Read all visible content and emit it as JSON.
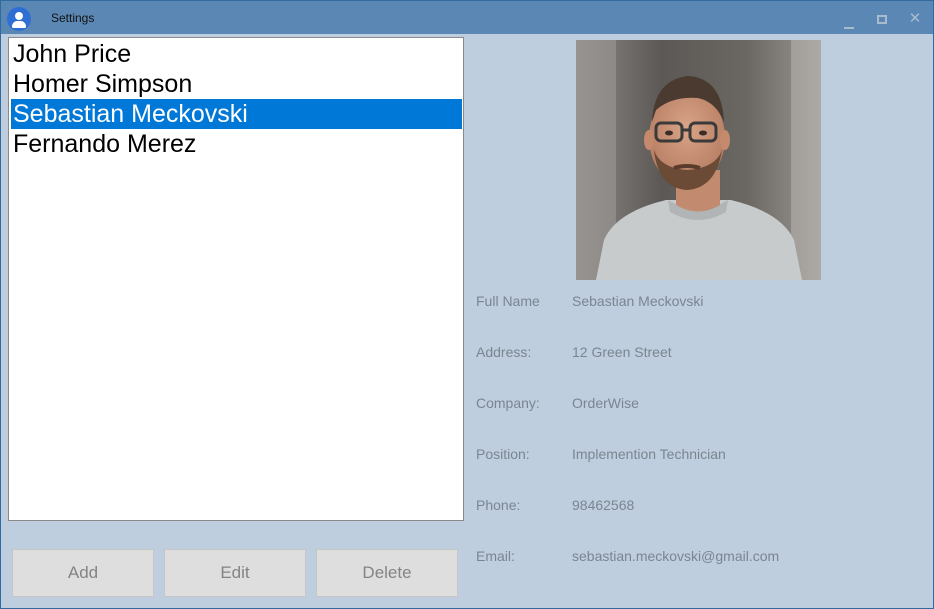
{
  "window": {
    "title": "Settings",
    "accent_color": "#5b87b5",
    "background_color": "#bfcede"
  },
  "contacts": {
    "items": [
      {
        "label": "John Price",
        "selected": false
      },
      {
        "label": "Homer Simpson",
        "selected": false
      },
      {
        "label": "Sebastian Meckovski",
        "selected": true
      },
      {
        "label": "Fernando Merez",
        "selected": false
      }
    ],
    "selection_color": "#0078d7"
  },
  "buttons": {
    "add_label": "Add",
    "edit_label": "Edit",
    "delete_label": "Delete"
  },
  "details": {
    "full_name": {
      "label": "Full Name",
      "value": "Sebastian Meckovski"
    },
    "address": {
      "label": "Address:",
      "value": "12 Green Street"
    },
    "company": {
      "label": "Company:",
      "value": "OrderWise"
    },
    "position": {
      "label": "Position:",
      "value": "Implemention Technician"
    },
    "phone": {
      "label": "Phone:",
      "value": "98462568"
    },
    "email": {
      "label": "Email:",
      "value": "sebastian.meckovski@gmail.com"
    }
  },
  "icons": {
    "app": "user-icon",
    "minimize": "minimize-icon",
    "maximize": "maximize-icon",
    "close": "close-icon"
  }
}
